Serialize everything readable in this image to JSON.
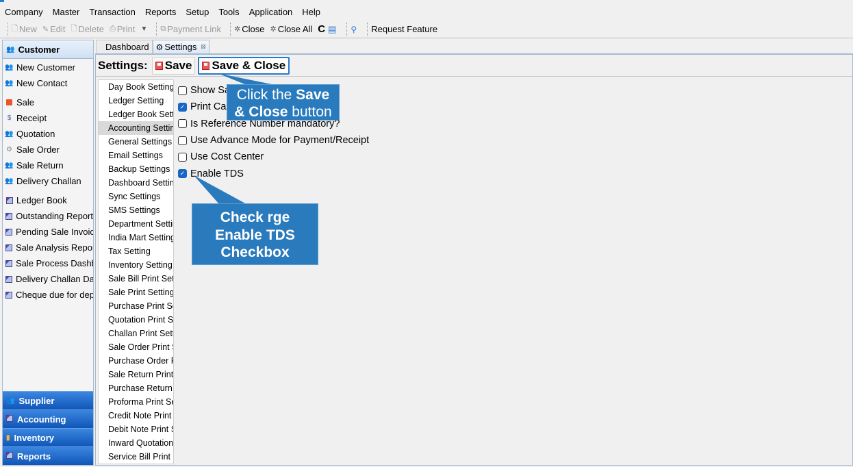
{
  "menubar": {
    "items": [
      "Company",
      "Master",
      "Transaction",
      "Reports",
      "Setup",
      "Tools",
      "Application",
      "Help"
    ]
  },
  "toolbar": {
    "new": "New",
    "edit": "Edit",
    "delete": "Delete",
    "print": "Print",
    "print_dropdown": "▼",
    "payment_link": "Payment Link",
    "close": "Close",
    "close_all": "Close All",
    "refresh": "C",
    "request_feature": "Request Feature"
  },
  "nav": {
    "header": "Customer",
    "items": [
      {
        "label": "New Customer",
        "icon": "person-icon"
      },
      {
        "label": "New Contact",
        "icon": "person-icon"
      },
      {
        "label": "Sale",
        "icon": "sale-icon"
      },
      {
        "label": "Receipt",
        "icon": "receipt-icon"
      },
      {
        "label": "Quotation",
        "icon": "person-icon"
      },
      {
        "label": "Sale Order",
        "icon": "order-icon"
      },
      {
        "label": "Sale Return",
        "icon": "person-icon"
      },
      {
        "label": "Delivery Challan",
        "icon": "person-icon"
      },
      {
        "label": "Ledger Book",
        "icon": "report-icon"
      },
      {
        "label": "Outstanding Report",
        "icon": "report-icon"
      },
      {
        "label": "Pending Sale Invoices",
        "icon": "report-icon"
      },
      {
        "label": "Sale Analysis Report",
        "icon": "report-icon"
      },
      {
        "label": "Sale Process Dashboard",
        "icon": "report-icon"
      },
      {
        "label": "Delivery Challan Dashboard",
        "icon": "report-icon"
      },
      {
        "label": "Cheque due for deposit",
        "icon": "report-icon"
      }
    ],
    "sections": [
      "Supplier",
      "Accounting",
      "Inventory",
      "Reports"
    ]
  },
  "tabs": {
    "dashboard": "Dashboard",
    "settings": "Settings",
    "close_glyph": "⊠"
  },
  "settings_bar": {
    "title": "Settings:",
    "save": "Save",
    "save_close": "Save & Close"
  },
  "settings_list": {
    "selected_index": 3,
    "items": [
      "Day Book Setting",
      "Ledger Setting",
      "Ledger Book Setting",
      "Accounting Setting",
      "General Settings",
      "Email Settings",
      "Backup Settings",
      "Dashboard Setting",
      "Sync Settings",
      "SMS Settings",
      "Department Setting",
      "India Mart Setting",
      "Tax Setting",
      "Inventory Setting",
      "Sale Bill Print Setting",
      "Sale Print Setting",
      "Purchase Print Setting",
      "Quotation Print Setting",
      "Challan Print Setting",
      "Sale Order Print Setting",
      "Purchase Order Print Setting",
      "Sale Return Print Setting",
      "Purchase Return Print Setting",
      "Proforma Print Setting",
      "Credit Note Print Setting",
      "Debit Note Print Setting",
      "Inward Quotation Print Setting",
      "Service Bill Print Setting"
    ]
  },
  "options": [
    {
      "label": "Show Sale Profit & Loss",
      "checked": false
    },
    {
      "label": "Print Cash Bank for Transactions",
      "checked": true
    },
    {
      "label": "Is Reference Number mandatory?",
      "checked": false
    },
    {
      "label": "Use Advance Mode for Payment/Receipt",
      "checked": false
    },
    {
      "label": "Use Cost Center",
      "checked": false
    },
    {
      "label": "Enable TDS",
      "checked": true
    }
  ],
  "callouts": {
    "save_close": {
      "pre": "Click the ",
      "bold1": "Save",
      "bold2": "& Close",
      "post": " button"
    },
    "tds": {
      "line1": "Check rge",
      "line2": "Enable TDS",
      "line3": "Checkbox"
    }
  },
  "colors": {
    "callout_bg": "#2a7bbd",
    "nav_section_bg": "#1a62c4",
    "checkbox_checked": "#1a66c4"
  }
}
